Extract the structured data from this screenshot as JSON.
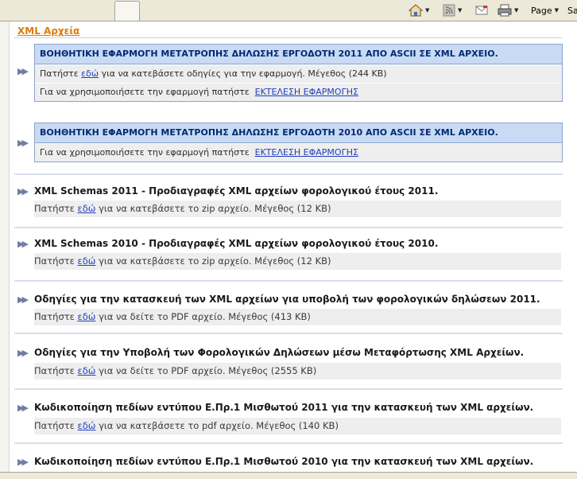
{
  "toolbar": {
    "page_label": "Page",
    "safety_label": "Sa"
  },
  "section": {
    "title": "XML Αρχεία"
  },
  "highlight_boxes": [
    {
      "header": "ΒΟΗΘΗΤΙΚΗ ΕΦΑΡΜΟΓΗ ΜΕΤΑΤΡΟΠΗΣ ΔΗΛΩΣΗΣ ΕΡΓΟΔΟΤΗ 2011 ΑΠΟ ASCII ΣΕ XML ΑΡΧΕΙΟ.",
      "row1_prefix": "Πατήστε",
      "row1_link": "εδώ",
      "row1_suffix": "για να κατεβάσετε οδηγίες για την εφαρμογή. Μέγεθος (244 KB)",
      "row2_prefix": "Για να χρησιμοποιήσετε την εφαρμογή πατήστε",
      "row2_link": "ΕΚΤΕΛΕΣΗ ΕΦΑΡΜΟΓΗΣ"
    },
    {
      "header": "ΒΟΗΘΗΤΙΚΗ ΕΦΑΡΜΟΓΗ ΜΕΤΑΤΡΟΠΗΣ ΔΗΛΩΣΗΣ ΕΡΓΟΔΟΤΗ 2010 ΑΠΟ ASCII ΣΕ XML ΑΡΧΕΙΟ.",
      "row2_prefix": "Για να χρησιμοποιήσετε την εφαρμογή πατήστε",
      "row2_link": "ΕΚΤΕΛΕΣΗ ΕΦΑΡΜΟΓΗΣ"
    }
  ],
  "items": [
    {
      "title": "XML Schemas 2011 - Προδιαγραφές XML αρχείων φορολογικού έτους 2011.",
      "prefix": "Πατήστε",
      "link": "εδώ",
      "suffix": "για να κατεβάσετε το zip αρχείο. Μέγεθος (12 KB)"
    },
    {
      "title": "XML Schemas 2010 - Προδιαγραφές XML αρχείων φορολογικού έτους 2010.",
      "prefix": "Πατήστε",
      "link": "εδώ",
      "suffix": "για να κατεβάσετε το zip αρχείο. Μέγεθος (12 KB)"
    },
    {
      "title": "Οδηγίες για την κατασκευή των XML αρχείων για υποβολή των φορολογικών δηλώσεων 2011.",
      "prefix": "Πατήστε",
      "link": "εδώ",
      "suffix": "για να δείτε το PDF αρχείο. Μέγεθος (413 KB)"
    },
    {
      "title": "Οδηγίες για την Υποβολή των Φορολογικών Δηλώσεων μέσω Μεταφόρτωσης XML Αρχείων.",
      "prefix": "Πατήστε",
      "link": "εδώ",
      "suffix": "για να δείτε το PDF αρχείο. Μέγεθος (2555 KB)"
    },
    {
      "title": "Κωδικοποίηση πεδίων εντύπου Ε.Πρ.1 Μισθωτού 2011 για την κατασκευή των XML αρχείων.",
      "prefix": "Πατήστε",
      "link": "εδώ",
      "suffix": "για να κατεβάσετε το pdf αρχείο. Μέγεθος (140 KB)"
    },
    {
      "title": "Κωδικοποίηση πεδίων εντύπου Ε.Πρ.1 Μισθωτού 2010 για την κατασκευή των XML αρχείων."
    }
  ]
}
